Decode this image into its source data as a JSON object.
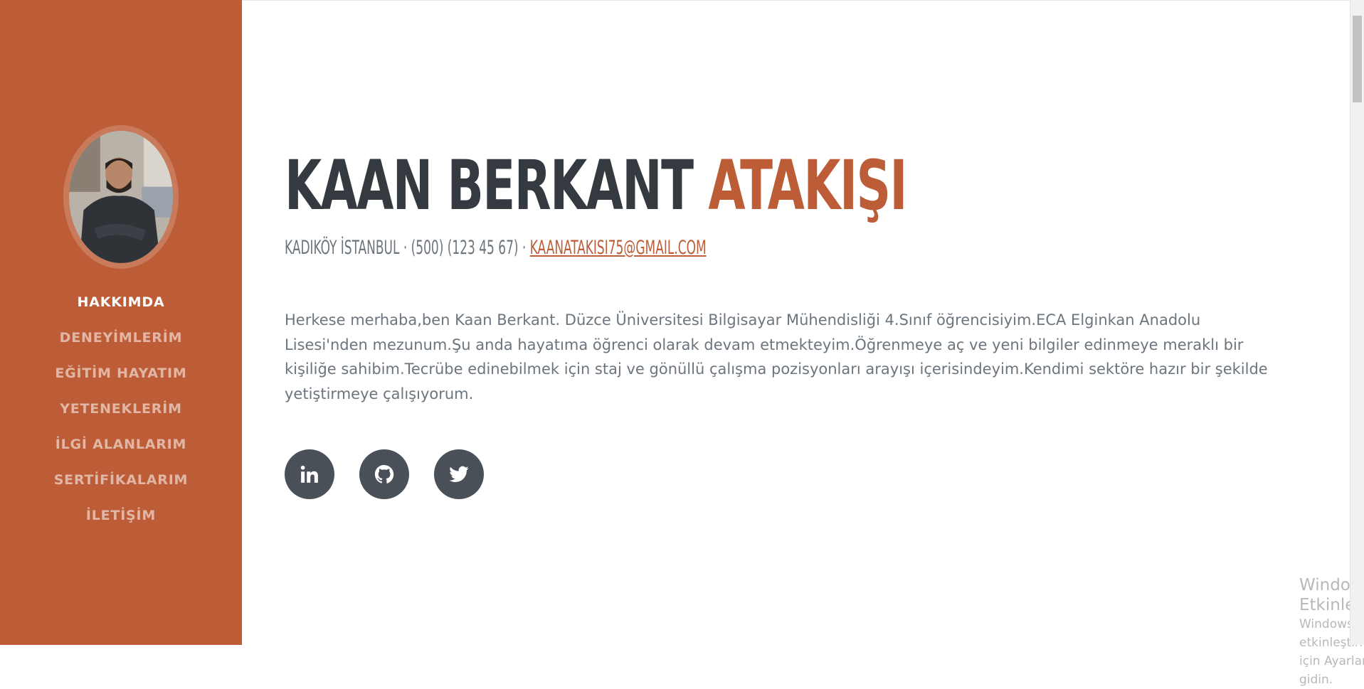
{
  "sidebar": {
    "avatar_alt": "profile-photo",
    "nav": [
      {
        "label": "HAKKIMDA",
        "active": true
      },
      {
        "label": "DENEYİMLERİM",
        "active": false
      },
      {
        "label": "EĞİTİM HAYATIM",
        "active": false
      },
      {
        "label": "YETENEKLERİM",
        "active": false
      },
      {
        "label": "İLGİ ALANLARIM",
        "active": false
      },
      {
        "label": "SERTİFİKALARIM",
        "active": false
      },
      {
        "label": "İLETİŞİM",
        "active": false
      }
    ]
  },
  "profile": {
    "first_name": "KAAN BERKANT",
    "last_name": "ATAKIŞI",
    "contact_prefix": "KADIKÖY İSTANBUL · (500) (123 45 67) · ",
    "email": "KAANATAKISI75@GMAIL.COM",
    "about": "Herkese merhaba,ben Kaan Berkant. Düzce Üniversitesi Bilgisayar Mühendisliği 4.Sınıf öğrencisiyim.ECA Elginkan Anadolu Lisesi'nden mezunum.Şu anda hayatıma öğrenci olarak devam etmekteyim.Öğrenmeye aç ve yeni bilgiler edinmeye meraklı bir kişiliğe sahibim.Tecrübe edinebilmek için staj ve gönüllü çalışma pozisyonları arayışı içerisindeyim.Kendimi sektöre hazır bir şekilde yetiştirmeye çalışıyorum."
  },
  "social": [
    {
      "name": "linkedin-icon"
    },
    {
      "name": "github-icon"
    },
    {
      "name": "twitter-icon"
    }
  ],
  "watermark": {
    "title": "Windows'u Etkinleştir",
    "subtitle": "Windows'u etkinleştirmek için Ayarlar'a gidin."
  },
  "colors": {
    "primary": "#bd5d38",
    "dark": "#343a40",
    "muted": "#6c757d",
    "social_bg": "#495057"
  }
}
